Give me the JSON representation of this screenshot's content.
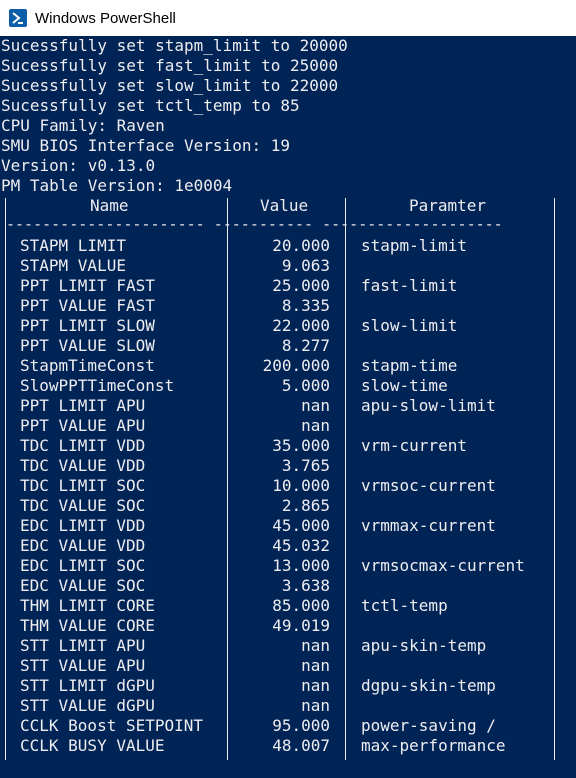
{
  "window": {
    "title": "Windows PowerShell"
  },
  "output_lines": [
    "Sucessfully set stapm_limit to 20000",
    "Sucessfully set fast_limit to 25000",
    "Sucessfully set slow_limit to 22000",
    "Sucessfully set tctl_temp to 85",
    "CPU Family: Raven",
    "SMU BIOS Interface Version: 19",
    "Version: v0.13.0",
    "PM Table Version: 1e0004"
  ],
  "table": {
    "headers": [
      "Name",
      "Value",
      "Paramter"
    ],
    "separator": "---------------------- ----------- --------------------",
    "rows": [
      {
        "name": "STAPM LIMIT",
        "value": "20.000",
        "param": "stapm-limit"
      },
      {
        "name": "STAPM VALUE",
        "value": "9.063",
        "param": ""
      },
      {
        "name": "PPT LIMIT FAST",
        "value": "25.000",
        "param": "fast-limit"
      },
      {
        "name": "PPT VALUE FAST",
        "value": "8.335",
        "param": ""
      },
      {
        "name": "PPT LIMIT SLOW",
        "value": "22.000",
        "param": "slow-limit"
      },
      {
        "name": "PPT VALUE SLOW",
        "value": "8.277",
        "param": ""
      },
      {
        "name": "StapmTimeConst",
        "value": "200.000",
        "param": "stapm-time"
      },
      {
        "name": "SlowPPTTimeConst",
        "value": "5.000",
        "param": "slow-time"
      },
      {
        "name": "PPT LIMIT APU",
        "value": "nan",
        "param": "apu-slow-limit"
      },
      {
        "name": "PPT VALUE APU",
        "value": "nan",
        "param": ""
      },
      {
        "name": "TDC LIMIT VDD",
        "value": "35.000",
        "param": "vrm-current"
      },
      {
        "name": "TDC VALUE VDD",
        "value": "3.765",
        "param": ""
      },
      {
        "name": "TDC LIMIT SOC",
        "value": "10.000",
        "param": "vrmsoc-current"
      },
      {
        "name": "TDC VALUE SOC",
        "value": "2.865",
        "param": ""
      },
      {
        "name": "EDC LIMIT VDD",
        "value": "45.000",
        "param": "vrmmax-current"
      },
      {
        "name": "EDC VALUE VDD",
        "value": "45.032",
        "param": ""
      },
      {
        "name": "EDC LIMIT SOC",
        "value": "13.000",
        "param": "vrmsocmax-current"
      },
      {
        "name": "EDC VALUE SOC",
        "value": "3.638",
        "param": ""
      },
      {
        "name": "THM LIMIT CORE",
        "value": "85.000",
        "param": "tctl-temp"
      },
      {
        "name": "THM VALUE CORE",
        "value": "49.019",
        "param": ""
      },
      {
        "name": "STT LIMIT APU",
        "value": "nan",
        "param": "apu-skin-temp"
      },
      {
        "name": "STT VALUE APU",
        "value": "nan",
        "param": ""
      },
      {
        "name": "STT LIMIT dGPU",
        "value": "nan",
        "param": "dgpu-skin-temp"
      },
      {
        "name": "STT VALUE dGPU",
        "value": "nan",
        "param": ""
      },
      {
        "name": "CCLK Boost SETPOINT",
        "value": "95.000",
        "param": "power-saving /"
      },
      {
        "name": "CCLK BUSY VALUE",
        "value": "48.007",
        "param": "max-performance"
      }
    ]
  },
  "colors": {
    "background": "#012456",
    "text": "#eeedf0",
    "titlebar": "#ffffff",
    "icon": "#0d5ea8"
  }
}
